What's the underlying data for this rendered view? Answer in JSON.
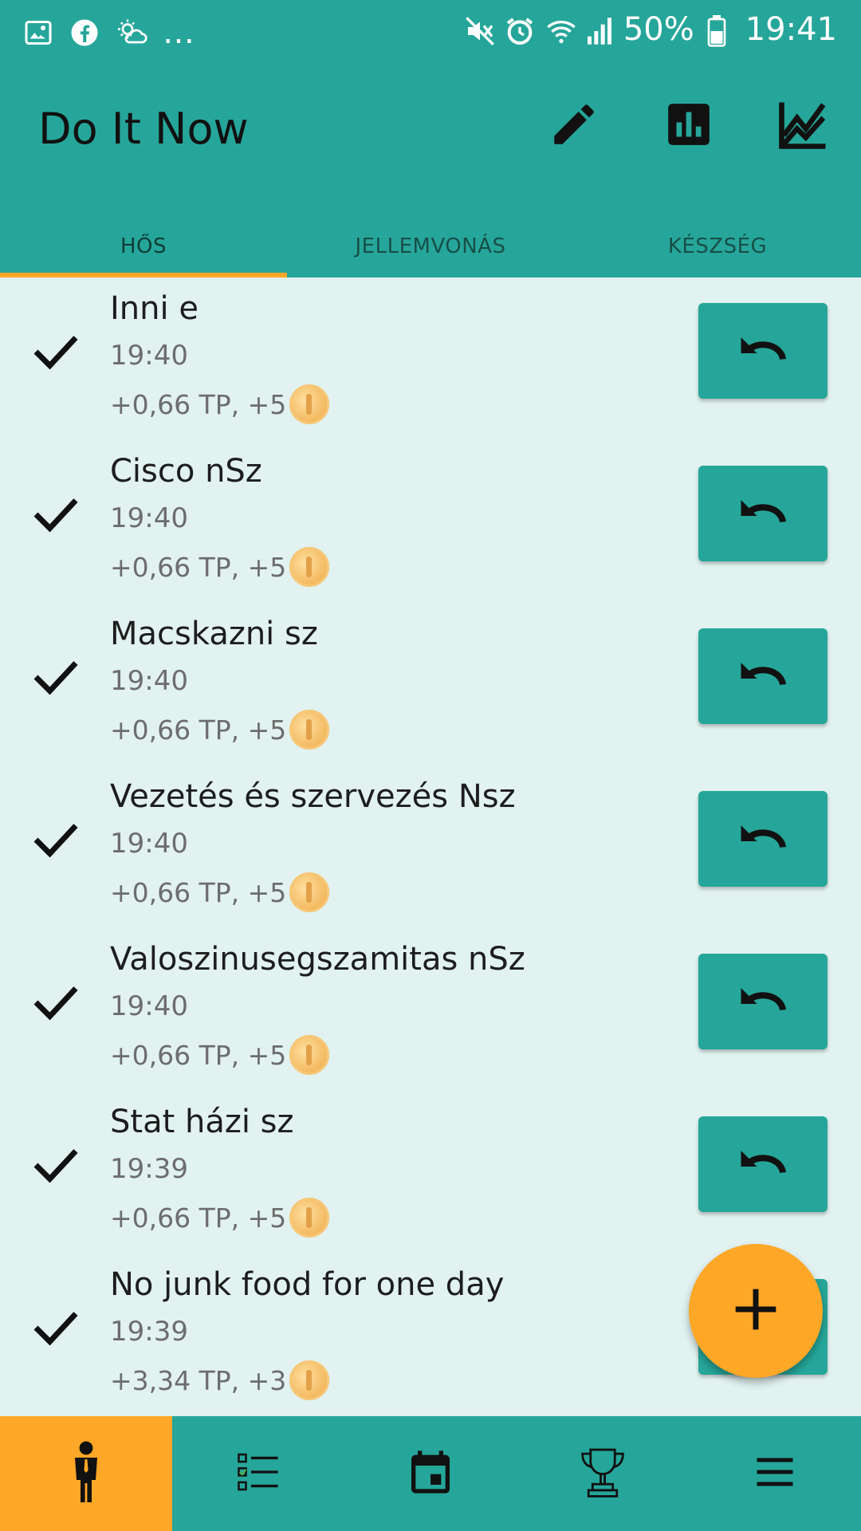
{
  "status_bar": {
    "left_icons": [
      "gallery-icon",
      "facebook-icon",
      "weather-icon"
    ],
    "more": "…",
    "right_icons": [
      "mute-icon",
      "alarm-icon",
      "wifi-icon",
      "signal-icon"
    ],
    "battery_percent": "50%",
    "time": "19:41"
  },
  "app_bar": {
    "title": "Do It Now",
    "actions": [
      "edit-icon",
      "bar-chart-icon",
      "line-chart-icon"
    ]
  },
  "tabs": [
    {
      "label": "HŐS",
      "active": true
    },
    {
      "label": "JELLEMVONÁS",
      "active": false
    },
    {
      "label": "KÉSZSÉG",
      "active": false
    }
  ],
  "items": [
    {
      "title": "Inni e",
      "time": "19:40",
      "reward": "+0,66 TP, +5"
    },
    {
      "title": "Cisco nSz",
      "time": "19:40",
      "reward": "+0,66 TP, +5"
    },
    {
      "title": "Macskazni sz",
      "time": "19:40",
      "reward": "+0,66 TP, +5"
    },
    {
      "title": "Vezetés és szervezés Nsz",
      "time": "19:40",
      "reward": "+0,66 TP, +5"
    },
    {
      "title": "Valoszinusegszamitas nSz",
      "time": "19:40",
      "reward": "+0,66 TP, +5"
    },
    {
      "title": "Stat házi sz",
      "time": "19:39",
      "reward": "+0,66 TP, +5"
    },
    {
      "title": "No junk food for one day",
      "time": "19:39",
      "reward": "+3,34 TP, +3"
    }
  ],
  "fab": {
    "icon": "plus-icon"
  },
  "bottom_nav": [
    {
      "icon": "hero-icon",
      "active": true
    },
    {
      "icon": "checklist-icon",
      "active": false
    },
    {
      "icon": "calendar-icon",
      "active": false
    },
    {
      "icon": "trophy-icon",
      "active": false
    },
    {
      "icon": "menu-icon",
      "active": false
    }
  ],
  "colors": {
    "primary": "#26a69a",
    "accent": "#ffa726",
    "background": "#e1f2f0"
  }
}
